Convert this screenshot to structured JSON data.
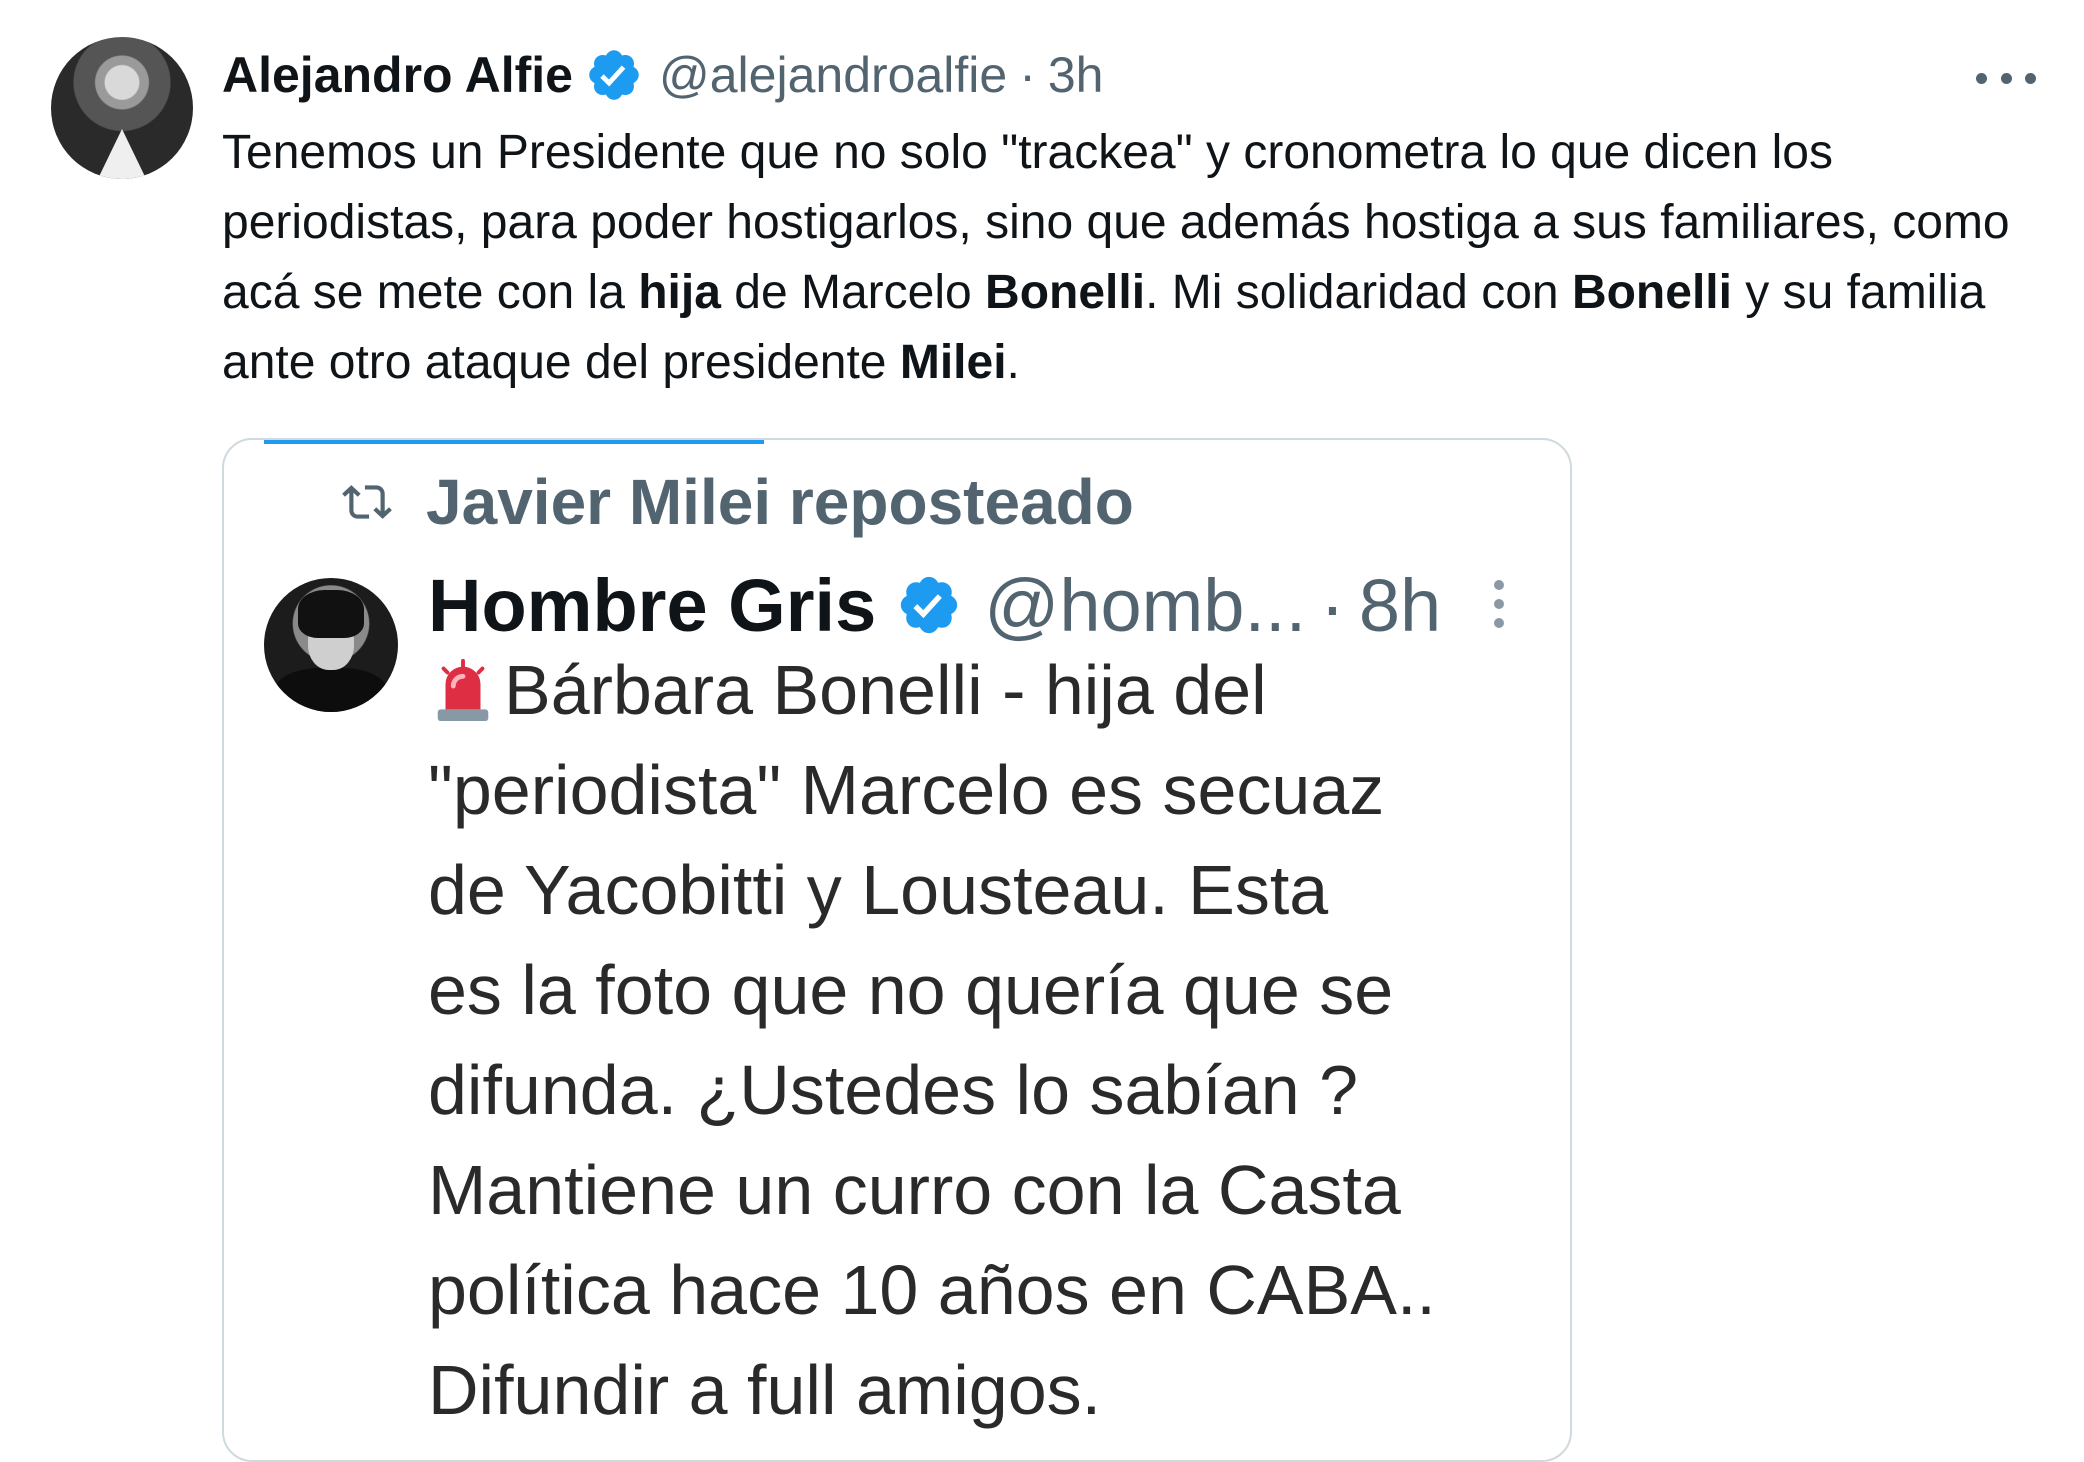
{
  "tweet": {
    "author_name": "Alejandro Alfie",
    "handle": "@alejandroalfie",
    "separator": "·",
    "time": "3h",
    "text_parts": [
      "Tenemos un Presidente que no solo \"trackea\" y cronometra lo que dicen los periodistas, para poder hostigarlos, sino que además hostiga a sus familiares, como acá se mete con la ",
      "hija",
      " de Marcelo ",
      "Bonelli",
      ". Mi solidaridad con ",
      "Bonelli",
      " y su familia ante otro ataque del presidente ",
      "Milei",
      "."
    ]
  },
  "embedded": {
    "repost_label": "Javier Milei reposteado",
    "author_name": "Hombre Gris",
    "handle": "@homb...",
    "separator": "·",
    "time": "8h",
    "text": "Bárbara Bonelli - hija del\n\"periodista\" Marcelo es secuaz\nde Yacobitti y  Lousteau.  Esta\nes la foto que no quería que se\ndifunda. ¿Ustedes lo sabían ?\nMantiene un curro con la Casta\npolítica hace 10 años en CABA..\nDifundir a full amigos."
  },
  "colors": {
    "verified": "#1d9bf0",
    "secondary_text": "#536471",
    "border": "#cfd9de"
  },
  "icons": [
    "verified-badge-icon",
    "more-options-icon",
    "repost-icon",
    "siren-emoji-icon"
  ]
}
